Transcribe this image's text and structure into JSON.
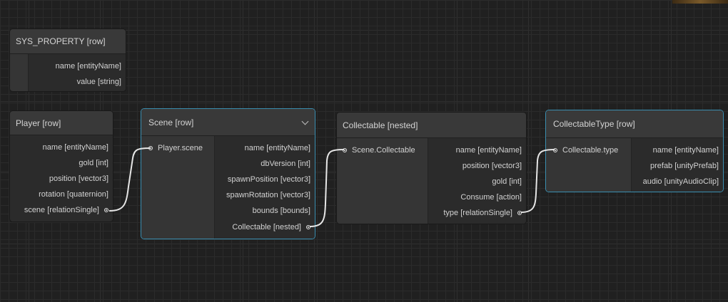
{
  "nodes": {
    "sys_property": {
      "title": "SYS_PROPERTY [row]",
      "fields": [
        "name [entityName]",
        "value [string]"
      ]
    },
    "player": {
      "title": "Player [row]",
      "fields": [
        "name [entityName]",
        "gold [int]",
        "position [vector3]",
        "rotation [quaternion]",
        "scene [relationSingle]"
      ]
    },
    "scene": {
      "title": "Scene [row]",
      "input": "Player.scene",
      "fields": [
        "name [entityName]",
        "dbVersion [int]",
        "spawnPosition [vector3]",
        "spawnRotation [vector3]",
        "bounds [bounds]",
        "Collectable [nested]"
      ]
    },
    "collectable": {
      "title": "Collectable [nested]",
      "input": "Scene.Collectable",
      "fields": [
        "name [entityName]",
        "position [vector3]",
        "gold [int]",
        "Consume [action]",
        "type [relationSingle]"
      ]
    },
    "collectable_type": {
      "title": "CollectableType [row]",
      "input": "Collectable.type",
      "fields": [
        "name [entityName]",
        "prefab [unityPrefab]",
        "audio [unityAudioClip]"
      ]
    }
  },
  "colors": {
    "background": "#202020",
    "node": "#2b2b2b",
    "header": "#393939",
    "selection": "#3a8eb0",
    "edge": "#e6e6e6"
  },
  "icons": {
    "collapse": "chevron-down-icon",
    "port": "port-pin-icon"
  }
}
